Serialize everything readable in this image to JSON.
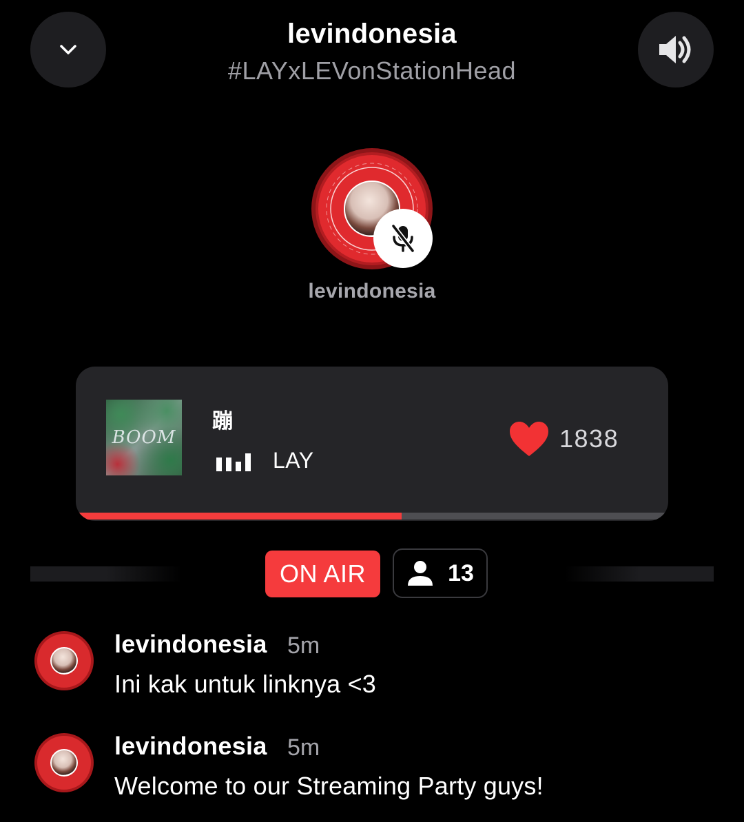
{
  "header": {
    "title": "levindonesia",
    "subtitle": "#LAYxLEVonStationHead",
    "collapse_icon": "chevron-down-icon",
    "volume_icon": "speaker-icon"
  },
  "host": {
    "name": "levindonesia",
    "avatar_icon": "avatar",
    "mic_state_icon": "mic-muted-icon"
  },
  "now_playing": {
    "title": "蹦",
    "artist": "LAY",
    "album_art_text": "BOOM",
    "like_count": "1838",
    "progress": 0.55,
    "accent_color": "#f53c3c"
  },
  "status": {
    "on_air_label": "ON AIR",
    "listener_count": "13"
  },
  "chat": [
    {
      "user": "levindonesia",
      "time": "5m",
      "text": "Ini kak untuk linknya <3"
    },
    {
      "user": "levindonesia",
      "time": "5m",
      "text": "Welcome to our Streaming Party guys!"
    }
  ]
}
